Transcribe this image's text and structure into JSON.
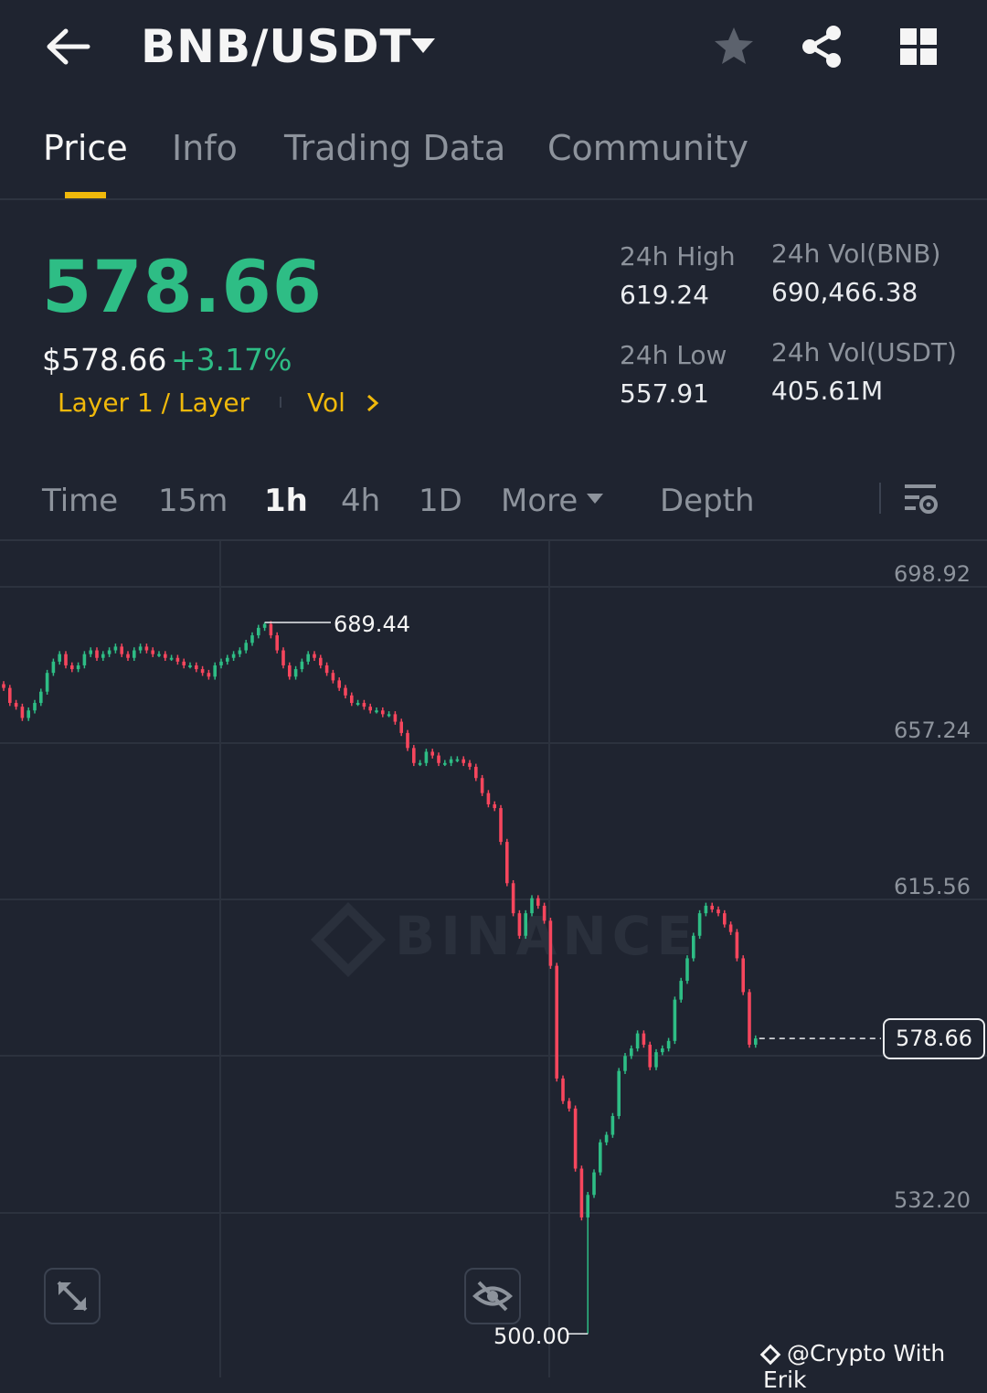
{
  "header": {
    "pair": "BNB/USDT",
    "icons": [
      "back-arrow-icon",
      "caret-down-icon",
      "star-icon",
      "share-icon",
      "grid-icon"
    ]
  },
  "tabs": [
    {
      "label": "Price",
      "active": true
    },
    {
      "label": "Info",
      "active": false
    },
    {
      "label": "Trading Data",
      "active": false
    },
    {
      "label": "Community",
      "active": false
    }
  ],
  "ticker": {
    "last_price": "578.66",
    "usd_price": "$578.66",
    "change": "+3.17%",
    "tag_category": "Layer 1 / Layer",
    "tag_vol": "Vol",
    "high_label": "24h High",
    "high_value": "619.24",
    "low_label": "24h Low",
    "low_value": "557.91",
    "vol_base_label": "24h Vol(BNB)",
    "vol_base_value": "690,466.38",
    "vol_quote_label": "24h Vol(USDT)",
    "vol_quote_value": "405.61M"
  },
  "intervals": [
    {
      "label": "Time",
      "active": false
    },
    {
      "label": "15m",
      "active": false
    },
    {
      "label": "1h",
      "active": true
    },
    {
      "label": "4h",
      "active": false
    },
    {
      "label": "1D",
      "active": false
    },
    {
      "label": "More",
      "active": false
    },
    {
      "label": "Depth",
      "active": false
    }
  ],
  "colors": {
    "up": "#2ebd85",
    "down": "#f6465d",
    "accent": "#f0b90b",
    "bg": "#1f2430"
  },
  "chart_data": {
    "type": "candlestick",
    "y_ticks": [
      "698.92",
      "657.24",
      "615.56",
      "532.20"
    ],
    "ylim": [
      482,
      711
    ],
    "current_price_label": "578.66",
    "high_marker": "689.44",
    "low_marker": "500.00",
    "watermark": "BINANCE",
    "closes": [
      672,
      668,
      667,
      664,
      666,
      668,
      671,
      676,
      679,
      681,
      678,
      677,
      678,
      681,
      682,
      680,
      681,
      682,
      683,
      681,
      680,
      682,
      683,
      682,
      681,
      681,
      680,
      680,
      679,
      678,
      678,
      677,
      676,
      675,
      678,
      679,
      680,
      681,
      682,
      684,
      686,
      688,
      689,
      686,
      682,
      678,
      675,
      677,
      679,
      681,
      680,
      678,
      676,
      674,
      672,
      670,
      668,
      668,
      667,
      666,
      666,
      665,
      665,
      663,
      660,
      656,
      652,
      652,
      655,
      654,
      652,
      652,
      653,
      653,
      652,
      651,
      648,
      644,
      641,
      640,
      631,
      620,
      612,
      606,
      612,
      616,
      614,
      610,
      598,
      568,
      562,
      560,
      544,
      531,
      537,
      543,
      551,
      553,
      558,
      570,
      574,
      576,
      580,
      577,
      571,
      575,
      576,
      578,
      589,
      594,
      600,
      606,
      612,
      614,
      613,
      612,
      609,
      607,
      600,
      591,
      577,
      578.66
    ],
    "credit": "@Crypto With Erik"
  }
}
